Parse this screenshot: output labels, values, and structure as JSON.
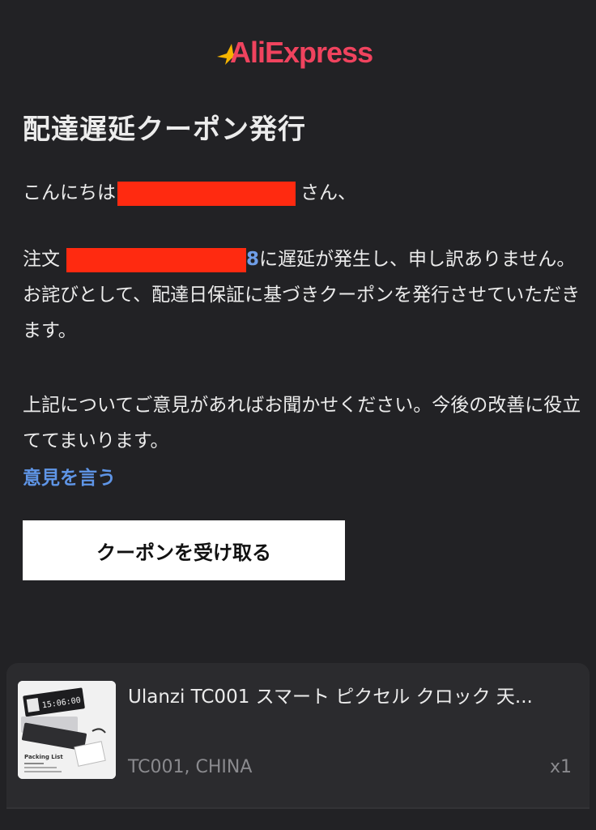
{
  "brand": {
    "name": "AliExpress",
    "color": "#f0435e",
    "star_color": "#f5b400"
  },
  "email": {
    "title": "配達遅延クーポン発行",
    "greeting_prefix": "こんにちは",
    "greeting_suffix": "さん、",
    "paragraph1_prefix": "注文",
    "order_visible_tail": "8",
    "paragraph1_suffix": "に遅延が発生し、申し訳ありません。お詫びとして、配達日保証に基づきクーポンを発行させていただきます。",
    "paragraph2": "上記についてご意見があればお聞かせください。今後の改善に役立ててまいります。",
    "feedback_link": "意見を言う",
    "cta_label": "クーポンを受け取る"
  },
  "product": {
    "name": "Ulanzi TC001 スマート ピクセル クロック 天...",
    "variant": "TC001, CHINA",
    "quantity": "x1",
    "thumb_display": "15:06:00",
    "thumb_caption": "Packing List"
  },
  "colors": {
    "background": "#222225",
    "link": "#5f95e6",
    "redaction": "#ff2a10"
  }
}
